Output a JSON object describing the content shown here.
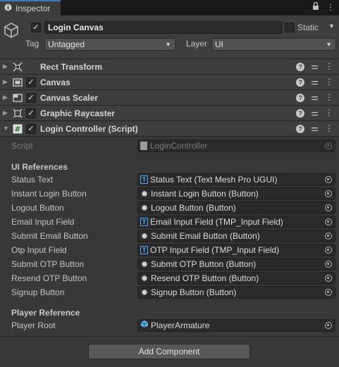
{
  "tab": {
    "title": "Inspector"
  },
  "header": {
    "object_name": "Login Canvas",
    "static_label": "Static",
    "tag_label": "Tag",
    "tag_value": "Untagged",
    "layer_label": "Layer",
    "layer_value": "UI"
  },
  "components": [
    {
      "title": "Rect Transform",
      "icon": "rect-transform-icon",
      "has_checkbox": false
    },
    {
      "title": "Canvas",
      "icon": "canvas-icon",
      "has_checkbox": true
    },
    {
      "title": "Canvas Scaler",
      "icon": "canvas-scaler-icon",
      "has_checkbox": true
    },
    {
      "title": "Graphic Raycaster",
      "icon": "graphic-raycaster-icon",
      "has_checkbox": true
    },
    {
      "title": "Login Controller (Script)",
      "icon": "script-icon",
      "has_checkbox": true
    }
  ],
  "script_field": {
    "label": "Script",
    "value": "LoginController"
  },
  "sections": {
    "ui_references": "UI References",
    "player_reference": "Player Reference"
  },
  "ui_fields": [
    {
      "label": "Status Text",
      "value": "Status Text (Text Mesh Pro UGUI)",
      "icon": "tmp"
    },
    {
      "label": "Instant Login Button",
      "value": "Instant Login Button (Button)",
      "icon": "button"
    },
    {
      "label": "Logout Button",
      "value": "Logout Button (Button)",
      "icon": "button"
    },
    {
      "label": "Email Input Field",
      "value": "Email Input Field (TMP_Input Field)",
      "icon": "tmp"
    },
    {
      "label": "Submit Email Button",
      "value": "Submit Email Button (Button)",
      "icon": "button"
    },
    {
      "label": "Otp Input Field",
      "value": "OTP Input Field (TMP_Input Field)",
      "icon": "tmp"
    },
    {
      "label": "Submit OTP Button",
      "value": "Submit OTP Button (Button)",
      "icon": "button"
    },
    {
      "label": "Resend OTP Button",
      "value": "Resend OTP Button (Button)",
      "icon": "button"
    },
    {
      "label": "Signup Button",
      "value": "Signup Button (Button)",
      "icon": "button"
    }
  ],
  "player_fields": [
    {
      "label": "Player Root",
      "value": "PlayerArmature",
      "icon": "prefab"
    }
  ],
  "footer": {
    "add_component_label": "Add Component"
  },
  "colors": {
    "background": "#383838",
    "header": "#3e3e3e",
    "accent": "#3a79bb",
    "tmp_icon": "#4aa6ff",
    "prefab_icon": "#5ab2f0"
  }
}
